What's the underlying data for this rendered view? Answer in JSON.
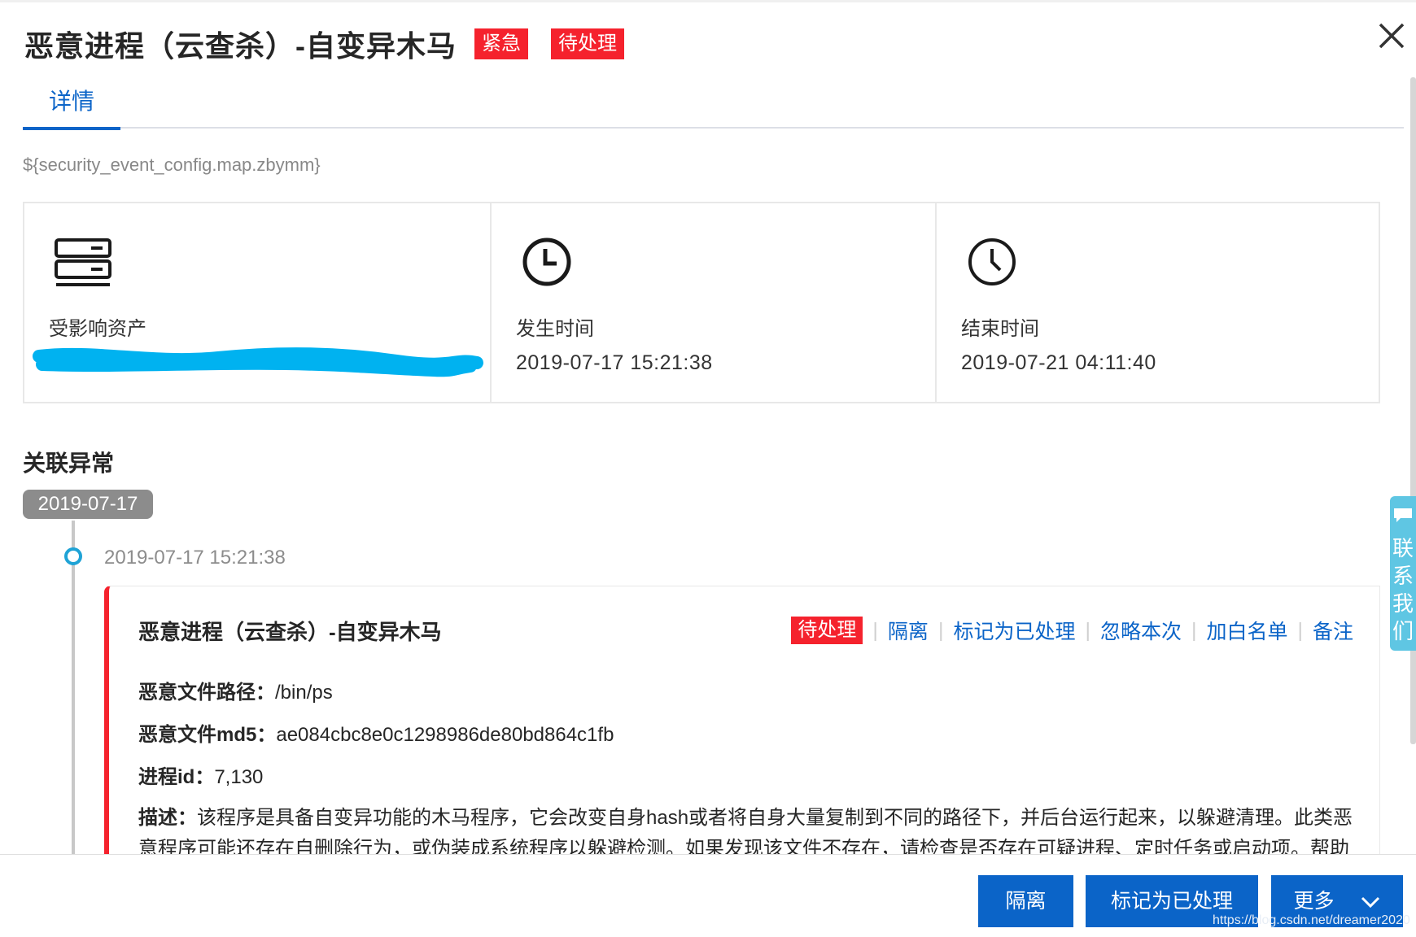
{
  "header": {
    "title": "恶意进程（云查杀）-自变异木马",
    "severity_tag": "紧急",
    "status_tag": "待处理"
  },
  "tabs": [
    {
      "label": "详情"
    }
  ],
  "subtitle": "${security_event_config.map.zbymm}",
  "cards": {
    "asset_label": "受影响资产",
    "start_label": "发生时间",
    "start_value": "2019-07-17 15:21:38",
    "end_label": "结束时间",
    "end_value": "2019-07-21 04:11:40"
  },
  "related": {
    "title": "关联异常",
    "date": "2019-07-17",
    "event_time": "2019-07-17 15:21:38",
    "event": {
      "title": "恶意进程（云查杀）-自变异木马",
      "status": "待处理",
      "actions": [
        "隔离",
        "标记为已处理",
        "忽略本次",
        "加白名单",
        "备注"
      ],
      "path_label": "恶意文件路径：",
      "path_value": "/bin/ps",
      "md5_label": "恶意文件md5：",
      "md5_value": "ae084cbc8e0c1298986de80bd864c1fb",
      "pid_label": "进程id：",
      "pid_value": "7,130",
      "desc_label": "描述：",
      "desc_value": "该程序是具备自变异功能的木马程序，它会改变自身hash或者将自身大量复制到不同的路径下，并后台运行起来，以躲避清理。此类恶意程序可能还存在自删除行为，或伪装成系统程序以躲避检测。如果发现该文件不存在，请检查是否存在可疑进程、定时任务或启动项。帮助"
    }
  },
  "footer": {
    "isolate": "隔离",
    "mark_handled": "标记为已处理",
    "more": "更多",
    "watermark": "https://blog.csdn.net/dreamer2020"
  },
  "side_widget": {
    "chars": [
      "联",
      "系",
      "我",
      "们"
    ]
  },
  "colors": {
    "primary": "#0b64c8",
    "danger": "#f5222d",
    "accent": "#1fa3d6"
  }
}
